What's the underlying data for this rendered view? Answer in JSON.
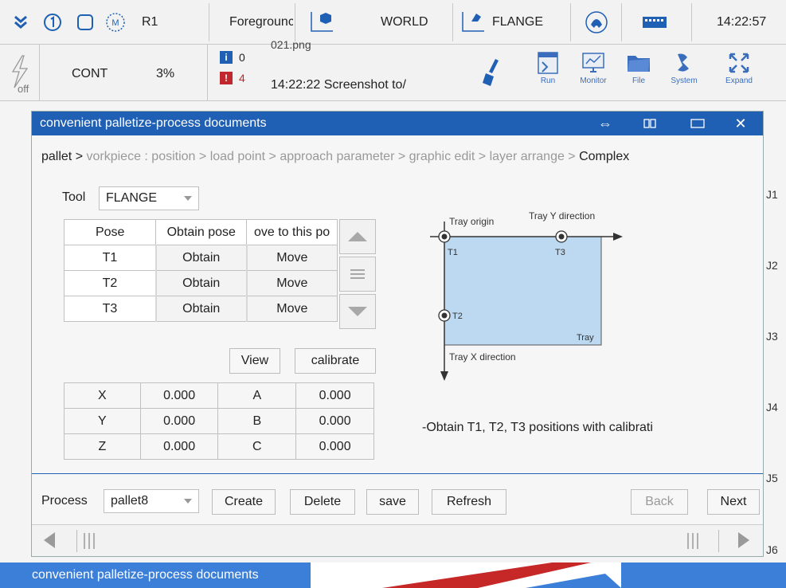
{
  "topbar": {
    "robot": "R1",
    "mode": "Foregrounc",
    "coord": "WORLD",
    "tool": "FLANGE",
    "time": "14:22:57"
  },
  "bar2": {
    "power_label": "off",
    "cont": "CONT",
    "speed": "3%",
    "info_count": "0",
    "error_count": "4",
    "msg_partial": "021.png",
    "message": "14:22:22 Screenshot to/",
    "tools": [
      {
        "label": "Run"
      },
      {
        "label": "Monitor"
      },
      {
        "label": "File"
      },
      {
        "label": "System"
      },
      {
        "label": "Expand"
      }
    ]
  },
  "window": {
    "title": "convenient palletize-process documents",
    "breadcrumb": {
      "first": "pallet >",
      "middle": " vorkpiece : position > load point > approach parameter > graphic edit > layer arrange > ",
      "last": "Complex"
    },
    "tool_label": "Tool",
    "tool_value": "FLANGE",
    "pose_table": {
      "headers": [
        "Pose",
        "Obtain pose",
        "ove to this po"
      ],
      "rows": [
        {
          "name": "T1",
          "obtain": "Obtain",
          "move": "Move"
        },
        {
          "name": "T2",
          "obtain": "Obtain",
          "move": "Move"
        },
        {
          "name": "T3",
          "obtain": "Obtain",
          "move": "Move"
        }
      ]
    },
    "view_label": "View",
    "calibrate_label": "calibrate",
    "coord_table": [
      {
        "k1": "X",
        "v1": "0.000",
        "k2": "A",
        "v2": "0.000"
      },
      {
        "k1": "Y",
        "v1": "0.000",
        "k2": "B",
        "v2": "0.000"
      },
      {
        "k1": "Z",
        "v1": "0.000",
        "k2": "C",
        "v2": "0.000"
      }
    ],
    "diagram": {
      "tray_origin": "Tray origin",
      "tray_y": "Tray Y direction",
      "tray_x": "Tray X direction",
      "tray": "Tray",
      "t1": "T1",
      "t2": "T2",
      "t3": "T3"
    },
    "hint": "-Obtain T1, T2, T3 positions with calibrati",
    "footer": {
      "process_label": "Process",
      "process_value": "pallet8",
      "create": "Create",
      "delete": "Delete",
      "save": "save",
      "refresh": "Refresh",
      "back": "Back",
      "next": "Next"
    }
  },
  "joints": [
    "J1",
    "J2",
    "J3",
    "J4",
    "J5",
    "J6"
  ],
  "taskbar": {
    "label": "convenient palletize-process documents"
  },
  "colors": {
    "title_blue": "#1f5fb4",
    "error_red": "#c0282d",
    "info_blue": "#1f5fb4",
    "tray_fill": "#bcd9f1"
  }
}
